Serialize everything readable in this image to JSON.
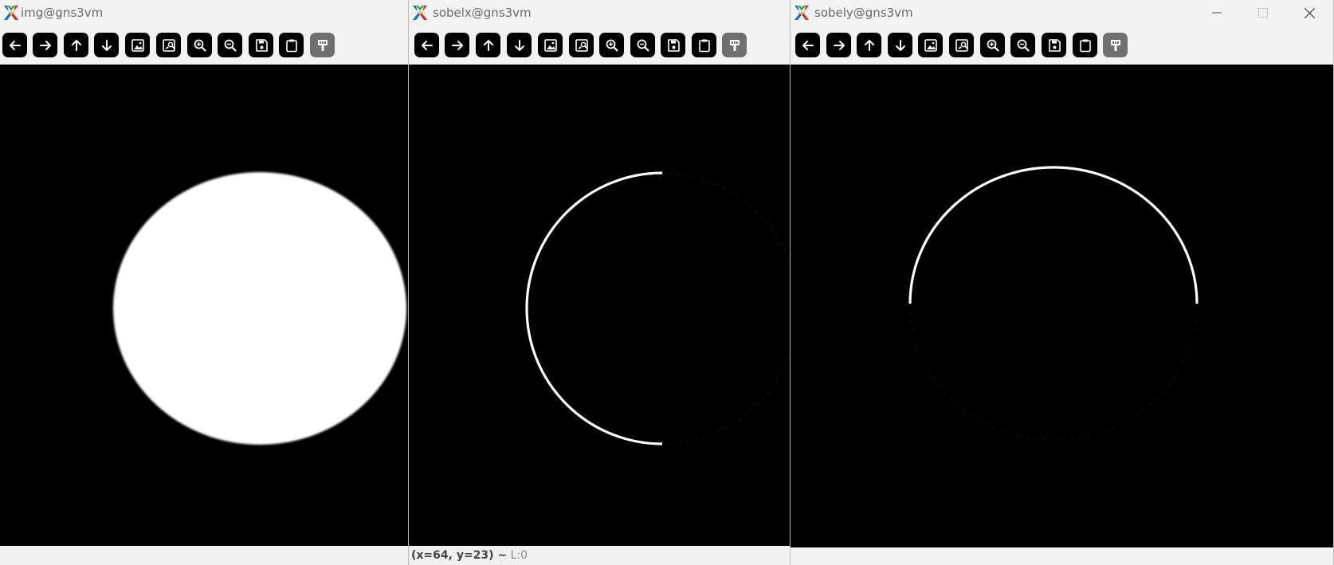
{
  "windows": [
    {
      "title": "img@gns3vm"
    },
    {
      "title": "sobelx@gns3vm"
    },
    {
      "title": "sobely@gns3vm"
    }
  ],
  "toolbar": {
    "tools": [
      "arrow-left-icon",
      "arrow-right-icon",
      "arrow-up-icon",
      "arrow-down-icon",
      "image-icon",
      "image-search-icon",
      "zoom-in-icon",
      "zoom-out-icon",
      "save-icon",
      "clipboard-icon",
      "paint-brush-icon"
    ]
  },
  "status": {
    "coords": "(x=64, y=23) ~",
    "level": "L:0"
  }
}
